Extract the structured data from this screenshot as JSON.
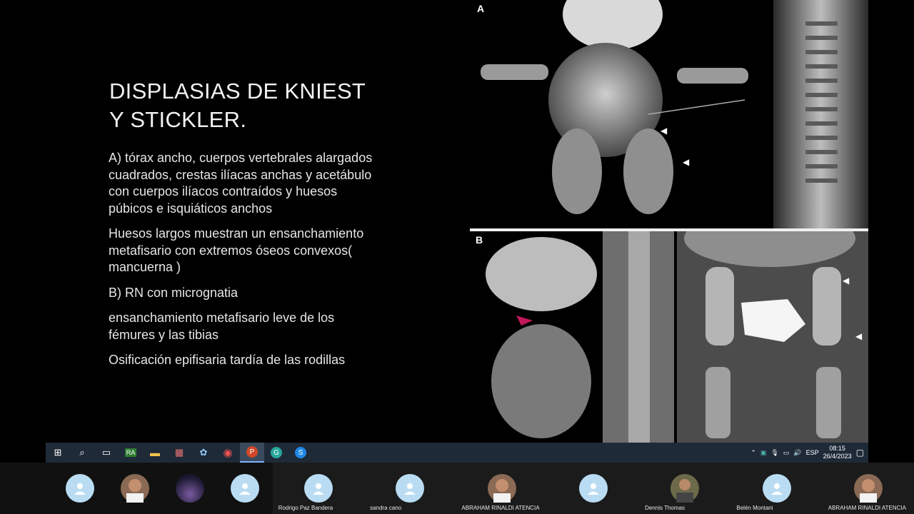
{
  "slide": {
    "title_line1": "DISPLASIAS DE KNIEST",
    "title_line2": "Y STICKLER.",
    "paragraphs": [
      "A) tórax ancho, cuerpos vertebrales alargados cuadrados, crestas ilíacas anchas y acetábulo con cuerpos ilíacos contraídos y huesos púbicos e isquiáticos anchos",
      "Huesos largos muestran un ensanchamiento metafisario con extremos óseos convexos( mancuerna )",
      "B) RN con micrognatia",
      "ensanchamiento metafisario leve de los fémures y las tibias",
      "Osificación epifisaria tardía de las rodillas"
    ],
    "panel_labels": {
      "a": "A",
      "b": "B"
    }
  },
  "taskbar": {
    "apps": [
      {
        "name": "windows-start-icon",
        "glyph": "⊞"
      },
      {
        "name": "search-icon",
        "glyph": "⌕"
      },
      {
        "name": "task-view-icon",
        "glyph": "▭"
      },
      {
        "name": "rinaldi-app-icon",
        "glyph": "RA"
      },
      {
        "name": "file-explorer-icon",
        "glyph": "▬"
      },
      {
        "name": "app-icon-5",
        "glyph": "▦"
      },
      {
        "name": "app-icon-6",
        "glyph": "✿"
      },
      {
        "name": "chrome-icon",
        "glyph": "◉"
      },
      {
        "name": "powerpoint-icon",
        "glyph": "P"
      },
      {
        "name": "app-g-icon",
        "glyph": "G"
      },
      {
        "name": "skype-icon",
        "glyph": "S"
      }
    ],
    "tray": {
      "language": "ESP",
      "time": "08:15",
      "date": "26/4/2023"
    }
  },
  "participants": [
    {
      "name": "",
      "type": "default"
    },
    {
      "name": "",
      "type": "photo"
    },
    {
      "name": "",
      "type": "night"
    },
    {
      "name": "",
      "type": "default"
    },
    {
      "name": "Rodrigo Paz Bandera",
      "type": "default"
    },
    {
      "name": "sandra cano",
      "type": "default"
    },
    {
      "name": "ABRAHAM RINALDI ATENCIA",
      "type": "photo"
    },
    {
      "name": "",
      "type": "default"
    },
    {
      "name": "Dennis Thomas",
      "type": "photo"
    },
    {
      "name": "Belén Montani",
      "type": "default"
    },
    {
      "name": "ABRAHAM RINALDI ATENCIA",
      "type": "photo"
    }
  ],
  "colors": {
    "taskbar_bg": "#1f2a38",
    "avatar_bg": "#b9dcf3",
    "marker_pink": "#c2185b"
  }
}
